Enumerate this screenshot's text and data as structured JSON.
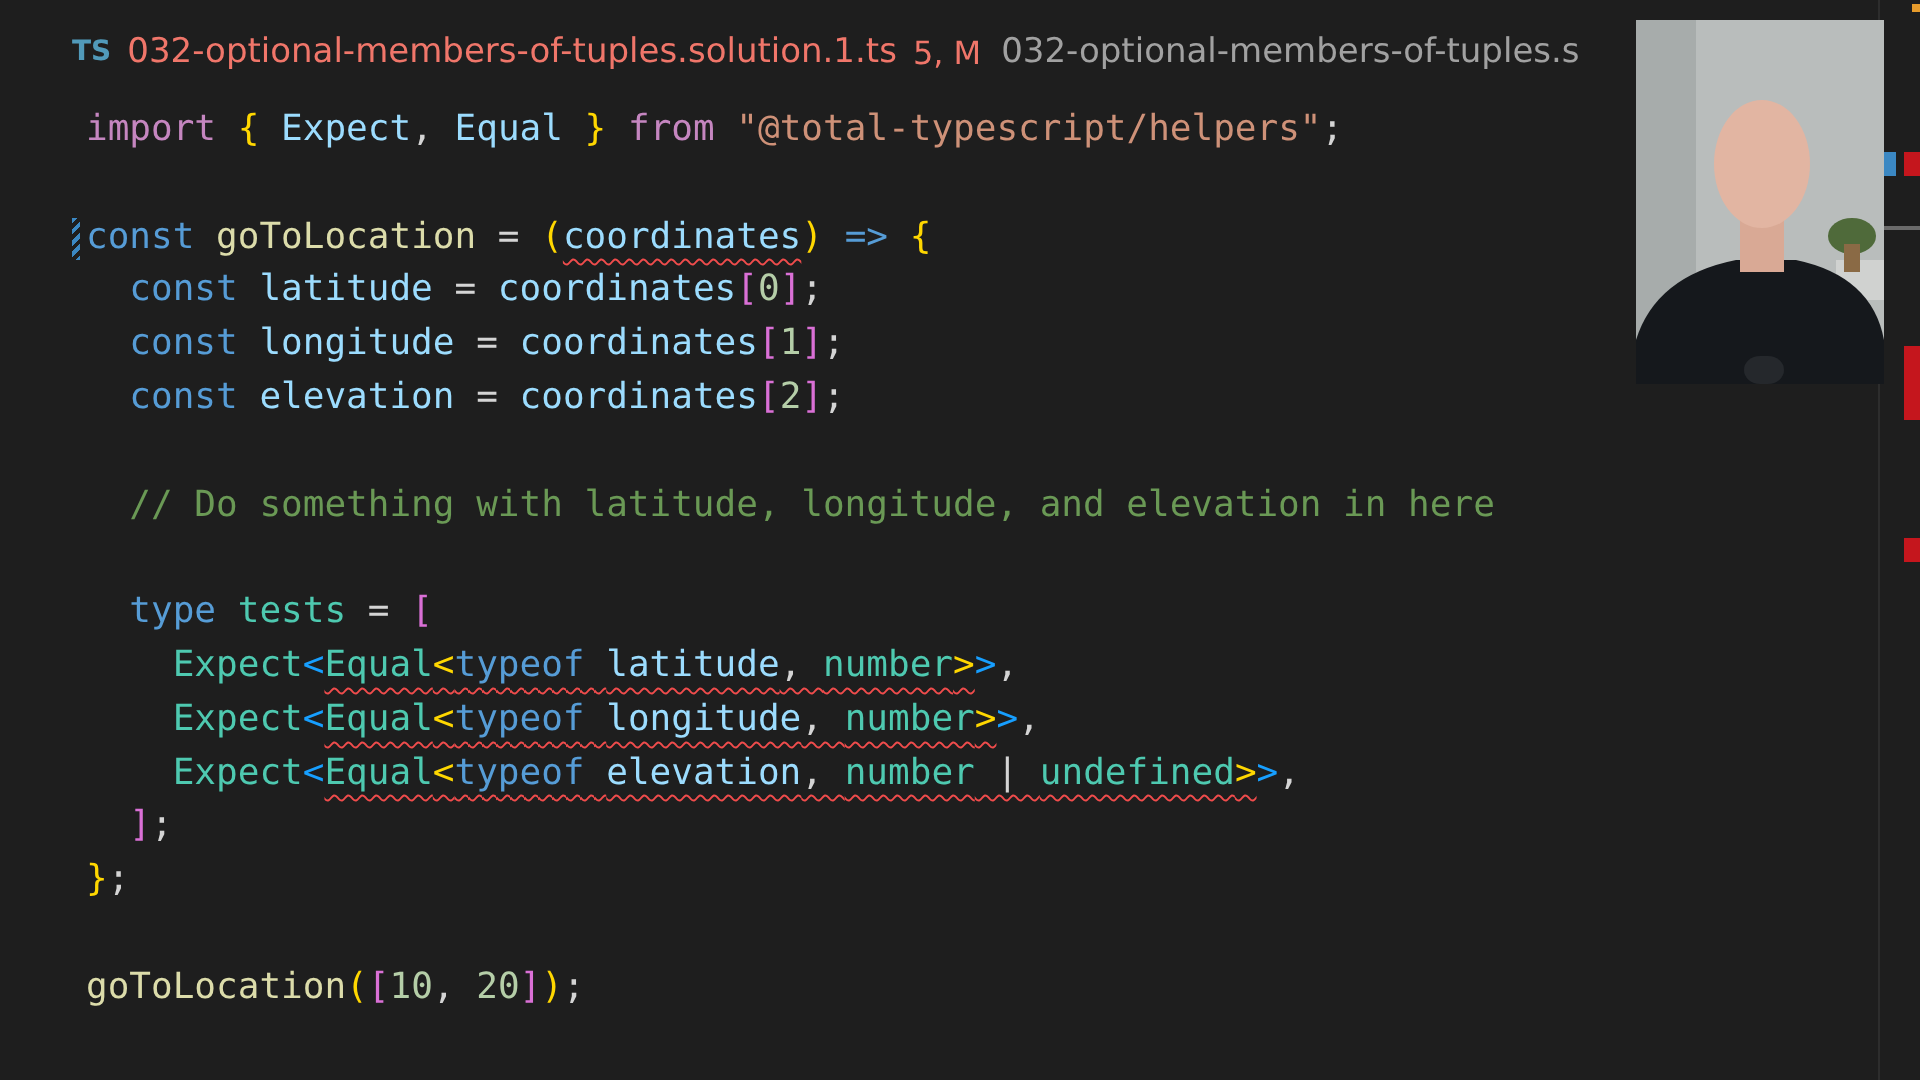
{
  "tabs": [
    {
      "icon_text": "TS",
      "title": "032-optional-members-of-tuples.solution.1.ts",
      "badge": "5, M",
      "selected": true,
      "has_errors": true
    },
    {
      "title": "032-optional-members-of-tuples.s",
      "selected": false,
      "has_errors": false
    }
  ],
  "editor": {
    "lines": [
      {
        "tokens": [
          {
            "kind": "control",
            "text": "import "
          },
          {
            "kind": "brace1",
            "text": "{ "
          },
          {
            "kind": "variable",
            "text": "Expect"
          },
          {
            "kind": "punct",
            "text": ", "
          },
          {
            "kind": "variable",
            "text": "Equal "
          },
          {
            "kind": "brace1",
            "text": "} "
          },
          {
            "kind": "control",
            "text": "from "
          },
          {
            "kind": "string",
            "text": "\"@total-typescript/helpers\""
          },
          {
            "kind": "punct",
            "text": ";"
          }
        ]
      },
      {
        "blank_before": true,
        "modified": true,
        "tokens": [
          {
            "kind": "keyword",
            "text": "const "
          },
          {
            "kind": "function",
            "text": "goToLocation"
          },
          {
            "kind": "punct",
            "text": " = "
          },
          {
            "kind": "brace1",
            "text": "("
          },
          {
            "kind": "variable",
            "text": "coordinates",
            "error": true
          },
          {
            "kind": "brace1",
            "text": ")"
          },
          {
            "kind": "keyword",
            "text": " => "
          },
          {
            "kind": "brace1",
            "text": "{"
          }
        ]
      },
      {
        "tokens": [
          {
            "kind": "keyword",
            "text": "  const "
          },
          {
            "kind": "variable",
            "text": "latitude"
          },
          {
            "kind": "punct",
            "text": " = "
          },
          {
            "kind": "variable",
            "text": "coordinates"
          },
          {
            "kind": "brace2",
            "text": "["
          },
          {
            "kind": "number",
            "text": "0"
          },
          {
            "kind": "brace2",
            "text": "]"
          },
          {
            "kind": "punct",
            "text": ";"
          }
        ]
      },
      {
        "tokens": [
          {
            "kind": "keyword",
            "text": "  const "
          },
          {
            "kind": "variable",
            "text": "longitude"
          },
          {
            "kind": "punct",
            "text": " = "
          },
          {
            "kind": "variable",
            "text": "coordinates"
          },
          {
            "kind": "brace2",
            "text": "["
          },
          {
            "kind": "number",
            "text": "1"
          },
          {
            "kind": "brace2",
            "text": "]"
          },
          {
            "kind": "punct",
            "text": ";"
          }
        ]
      },
      {
        "tokens": [
          {
            "kind": "keyword",
            "text": "  const "
          },
          {
            "kind": "variable",
            "text": "elevation"
          },
          {
            "kind": "punct",
            "text": " = "
          },
          {
            "kind": "variable",
            "text": "coordinates"
          },
          {
            "kind": "brace2",
            "text": "["
          },
          {
            "kind": "number",
            "text": "2"
          },
          {
            "kind": "brace2",
            "text": "]"
          },
          {
            "kind": "punct",
            "text": ";"
          }
        ]
      },
      {
        "blank_before": true,
        "tokens": [
          {
            "kind": "comment",
            "text": "  // Do something with latitude, longitude, and elevation in here"
          }
        ]
      },
      {
        "blank_before": true,
        "tokens": [
          {
            "kind": "keyword",
            "text": "  type "
          },
          {
            "kind": "type",
            "text": "tests"
          },
          {
            "kind": "punct",
            "text": " = "
          },
          {
            "kind": "brace2",
            "text": "["
          }
        ]
      },
      {
        "tokens": [
          {
            "kind": "type",
            "text": "    Expect"
          },
          {
            "kind": "brace3",
            "text": "<"
          },
          {
            "kind": "type",
            "text": "Equal",
            "error": true
          },
          {
            "kind": "brace1",
            "text": "<",
            "error": true
          },
          {
            "kind": "keyword",
            "text": "typeof ",
            "error": true
          },
          {
            "kind": "variable",
            "text": "latitude",
            "error": true
          },
          {
            "kind": "punct",
            "text": ", ",
            "error": true
          },
          {
            "kind": "type",
            "text": "number",
            "error": true
          },
          {
            "kind": "brace1",
            "text": ">",
            "error": true
          },
          {
            "kind": "brace3",
            "text": ">"
          },
          {
            "kind": "punct",
            "text": ","
          }
        ]
      },
      {
        "tokens": [
          {
            "kind": "type",
            "text": "    Expect"
          },
          {
            "kind": "brace3",
            "text": "<"
          },
          {
            "kind": "type",
            "text": "Equal",
            "error": true
          },
          {
            "kind": "brace1",
            "text": "<",
            "error": true
          },
          {
            "kind": "keyword",
            "text": "typeof ",
            "error": true
          },
          {
            "kind": "variable",
            "text": "longitude",
            "error": true
          },
          {
            "kind": "punct",
            "text": ", ",
            "error": true
          },
          {
            "kind": "type",
            "text": "number",
            "error": true
          },
          {
            "kind": "brace1",
            "text": ">",
            "error": true
          },
          {
            "kind": "brace3",
            "text": ">"
          },
          {
            "kind": "punct",
            "text": ","
          }
        ]
      },
      {
        "tokens": [
          {
            "kind": "type",
            "text": "    Expect"
          },
          {
            "kind": "brace3",
            "text": "<"
          },
          {
            "kind": "type",
            "text": "Equal",
            "error": true
          },
          {
            "kind": "brace1",
            "text": "<",
            "error": true
          },
          {
            "kind": "keyword",
            "text": "typeof ",
            "error": true
          },
          {
            "kind": "variable",
            "text": "elevation",
            "error": true
          },
          {
            "kind": "punct",
            "text": ", ",
            "error": true
          },
          {
            "kind": "type",
            "text": "number",
            "error": true
          },
          {
            "kind": "punct",
            "text": " | ",
            "error": true
          },
          {
            "kind": "type",
            "text": "undefined",
            "error": true
          },
          {
            "kind": "brace1",
            "text": ">",
            "error": true
          },
          {
            "kind": "brace3",
            "text": ">"
          },
          {
            "kind": "punct",
            "text": ","
          }
        ]
      },
      {
        "tokens": [
          {
            "kind": "brace2",
            "text": "  ]"
          },
          {
            "kind": "punct",
            "text": ";"
          }
        ]
      },
      {
        "tokens": [
          {
            "kind": "brace1",
            "text": "}"
          },
          {
            "kind": "punct",
            "text": ";"
          }
        ]
      },
      {
        "blank_before": true,
        "tokens": [
          {
            "kind": "function",
            "text": "goToLocation"
          },
          {
            "kind": "brace1",
            "text": "("
          },
          {
            "kind": "brace2",
            "text": "["
          },
          {
            "kind": "number",
            "text": "10"
          },
          {
            "kind": "punct",
            "text": ", "
          },
          {
            "kind": "number",
            "text": "20"
          },
          {
            "kind": "brace2",
            "text": "]"
          },
          {
            "kind": "brace1",
            "text": ")"
          },
          {
            "kind": "punct",
            "text": ";"
          }
        ]
      }
    ]
  }
}
